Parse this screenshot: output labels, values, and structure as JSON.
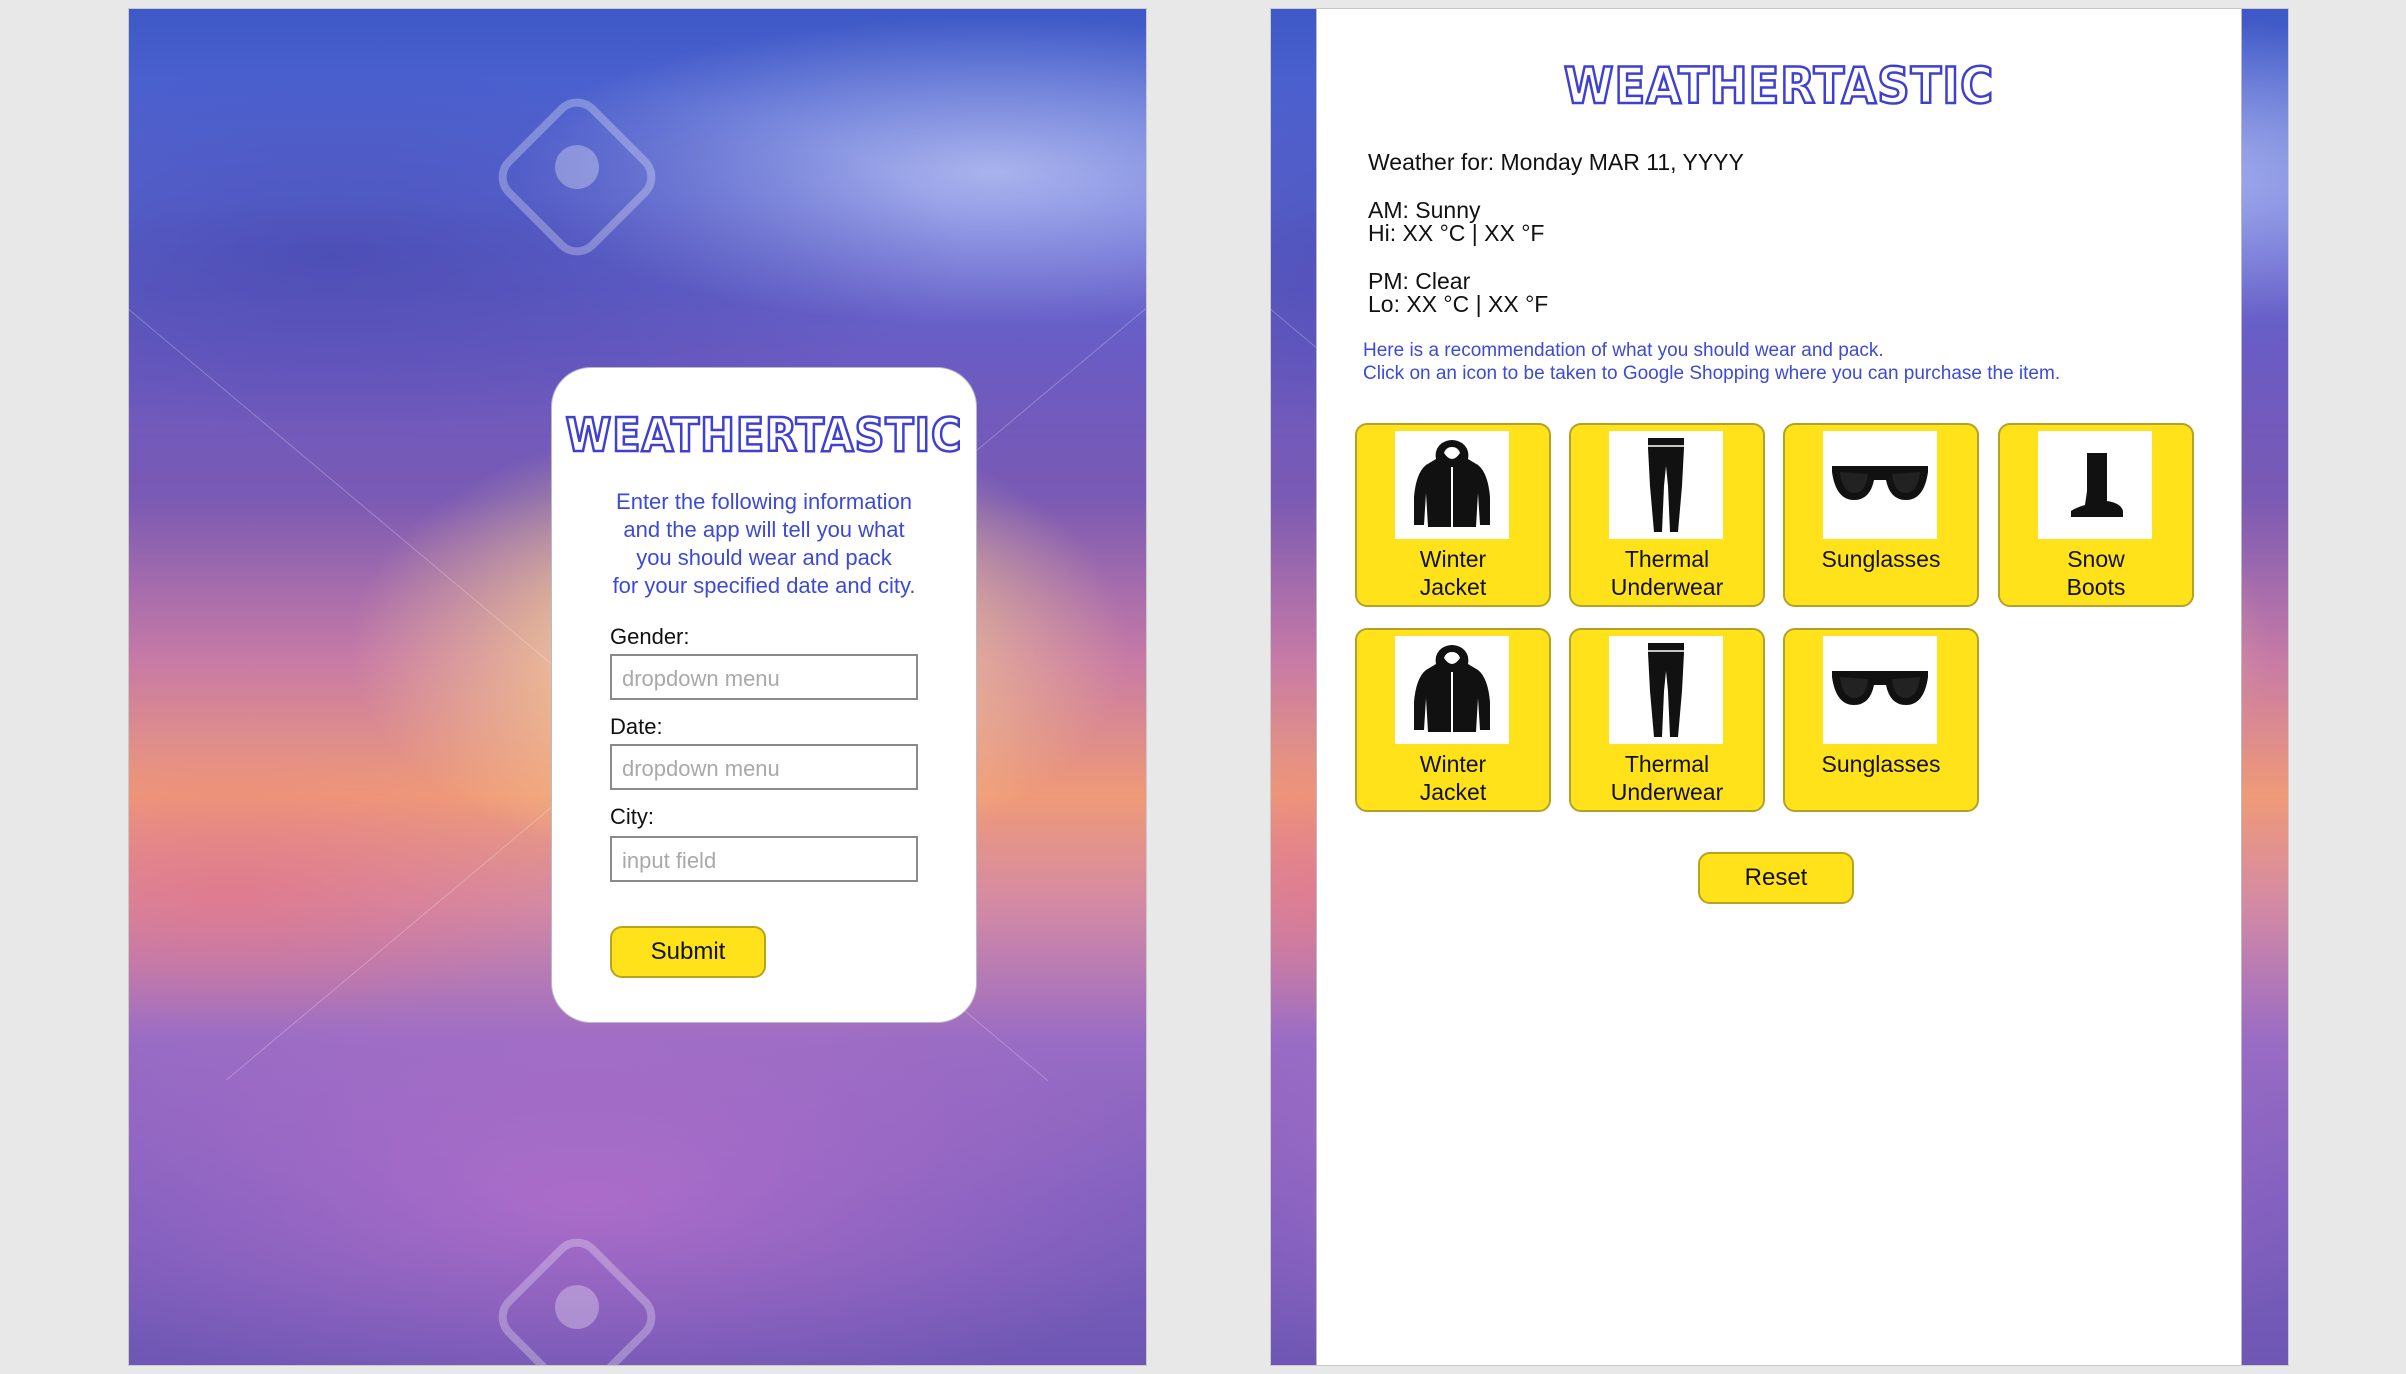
{
  "app": {
    "name": "WEATHERTASTIC"
  },
  "form_screen": {
    "intro": "Enter the following information\nand the app will tell you what\nyou should wear and pack\nfor your specified date and city.",
    "gender": {
      "label": "Gender:",
      "placeholder": "dropdown menu"
    },
    "date": {
      "label": "Date:",
      "placeholder": "dropdown menu"
    },
    "city": {
      "label": "City:",
      "placeholder": "input field"
    },
    "submit_label": "Submit"
  },
  "results_screen": {
    "weather_for": "Weather for: Monday MAR 11, YYYY",
    "am_condition": "AM: Sunny",
    "hi": "Hi: XX °C | XX °F",
    "pm_condition": "PM: Clear",
    "lo": "Lo: XX °C | XX °F",
    "recommendation_line1": "Here is a recommendation of what you should wear and pack.",
    "recommendation_line2": "Click on an icon to be taken to Google Shopping where you can purchase the item.",
    "items": [
      {
        "label": "Winter\nJacket",
        "icon": "jacket-icon"
      },
      {
        "label": "Thermal\nUnderwear",
        "icon": "leggings-icon"
      },
      {
        "label": "Sunglasses",
        "icon": "sunglasses-icon"
      },
      {
        "label": "Snow\nBoots",
        "icon": "boot-icon"
      },
      {
        "label": "Winter\nJacket",
        "icon": "jacket-icon"
      },
      {
        "label": "Thermal\nUnderwear",
        "icon": "leggings-icon"
      },
      {
        "label": "Sunglasses",
        "icon": "sunglasses-icon"
      }
    ],
    "reset_label": "Reset"
  },
  "colors": {
    "accent_blue": "#3f3fd1",
    "button_yellow": "#ffe21a"
  }
}
